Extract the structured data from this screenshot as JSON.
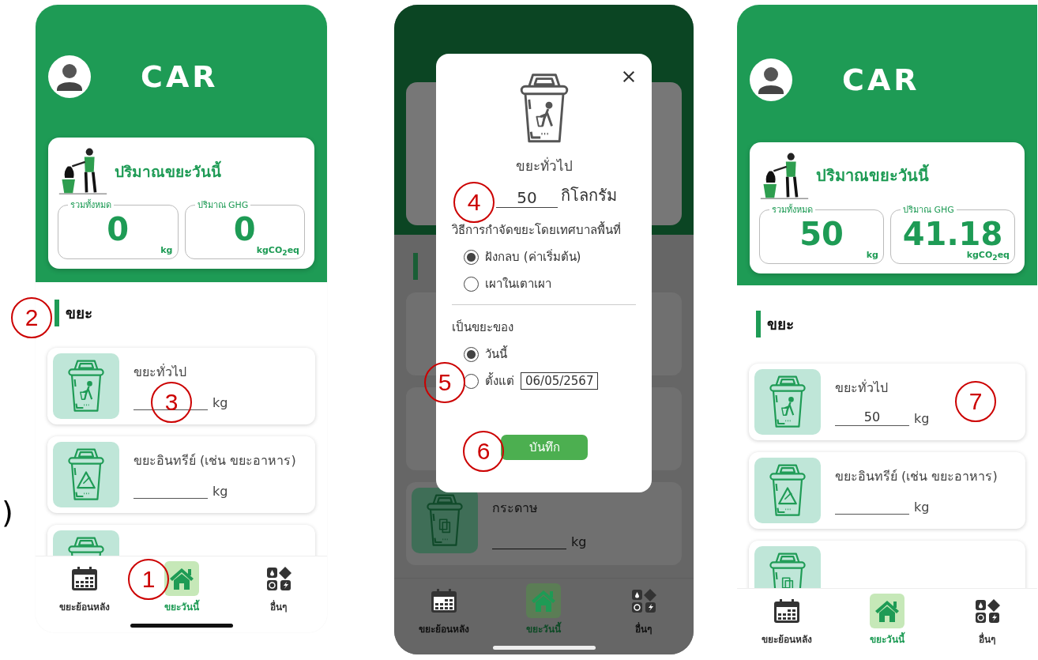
{
  "edge_fragment": ")",
  "phones": [
    {
      "kind": "home",
      "title": "CAR",
      "summary": {
        "title": "ปริมาณขยะวันนี้",
        "total": {
          "label": "รวมทั้งหมด",
          "value": "0",
          "unit": "kg"
        },
        "ghg": {
          "label": "ปริมาณ GHG",
          "value": "0",
          "unit": "kgCO$_{2}$eq"
        }
      },
      "section_title": "ขยะ",
      "waste_items": [
        {
          "kind": "general",
          "name": "ขยะทั่วไป",
          "unit": "kg"
        },
        {
          "kind": "organic",
          "name": "ขยะอินทรีย์ (เช่น ขยะอาหาร)",
          "unit": "kg"
        },
        {
          "kind": "paper"
        }
      ],
      "nav": [
        {
          "label": "ขยะย้อนหลัง",
          "selected": false
        },
        {
          "label": "ขยะวันนี้",
          "selected": true
        },
        {
          "label": "อื่นๆ",
          "selected": false
        }
      ],
      "annotations": [
        "1",
        "2",
        "3"
      ]
    },
    {
      "kind": "dialog",
      "waste_items": [
        {
          "kind": "paper",
          "name": "กระดาษ",
          "unit": "kg"
        }
      ],
      "nav": [
        {
          "label": "ขยะย้อนหลัง",
          "selected": false
        },
        {
          "label": "ขยะวันนี้",
          "selected": true
        },
        {
          "label": "อื่นๆ",
          "selected": false
        }
      ],
      "dialog": {
        "title": "ขยะทั่วไป",
        "amount": "50",
        "amount_unit": "กิโลกรัม",
        "method_label": "วิธีการกำจัดขยะโดยเทศบาลพื้นที่",
        "methods": [
          {
            "label": "ฝังกลบ (ค่าเริ่มต้น)",
            "selected": true
          },
          {
            "label": "เผาในเตาเผา",
            "selected": false
          }
        ],
        "date_label": "เป็นขยะของ",
        "date_options": [
          {
            "label": "วันนี้",
            "selected": true
          },
          {
            "label": "ตั้งแต่",
            "selected": false,
            "date": "06/05/2567"
          }
        ],
        "save": "บันทึก"
      },
      "annotations": [
        "4",
        "5",
        "6"
      ]
    },
    {
      "kind": "home",
      "title": "CAR",
      "summary": {
        "title": "ปริมาณขยะวันนี้",
        "total": {
          "label": "รวมทั้งหมด",
          "value": "50",
          "unit": "kg"
        },
        "ghg": {
          "label": "ปริมาณ GHG",
          "value": "41.18",
          "unit": "kgCO$_{2}$eq"
        }
      },
      "section_title": "ขยะ",
      "waste_items": [
        {
          "kind": "general",
          "name": "ขยะทั่วไป",
          "value": "50",
          "unit": "kg"
        },
        {
          "kind": "organic",
          "name": "ขยะอินทรีย์ (เช่น ขยะอาหาร)",
          "unit": "kg"
        },
        {
          "kind": "paper"
        }
      ],
      "nav": [
        {
          "label": "ขยะย้อนหลัง",
          "selected": false
        },
        {
          "label": "ขยะวันนี้",
          "selected": true
        },
        {
          "label": "อื่นๆ",
          "selected": false
        }
      ],
      "annotations": [
        "7"
      ]
    }
  ]
}
